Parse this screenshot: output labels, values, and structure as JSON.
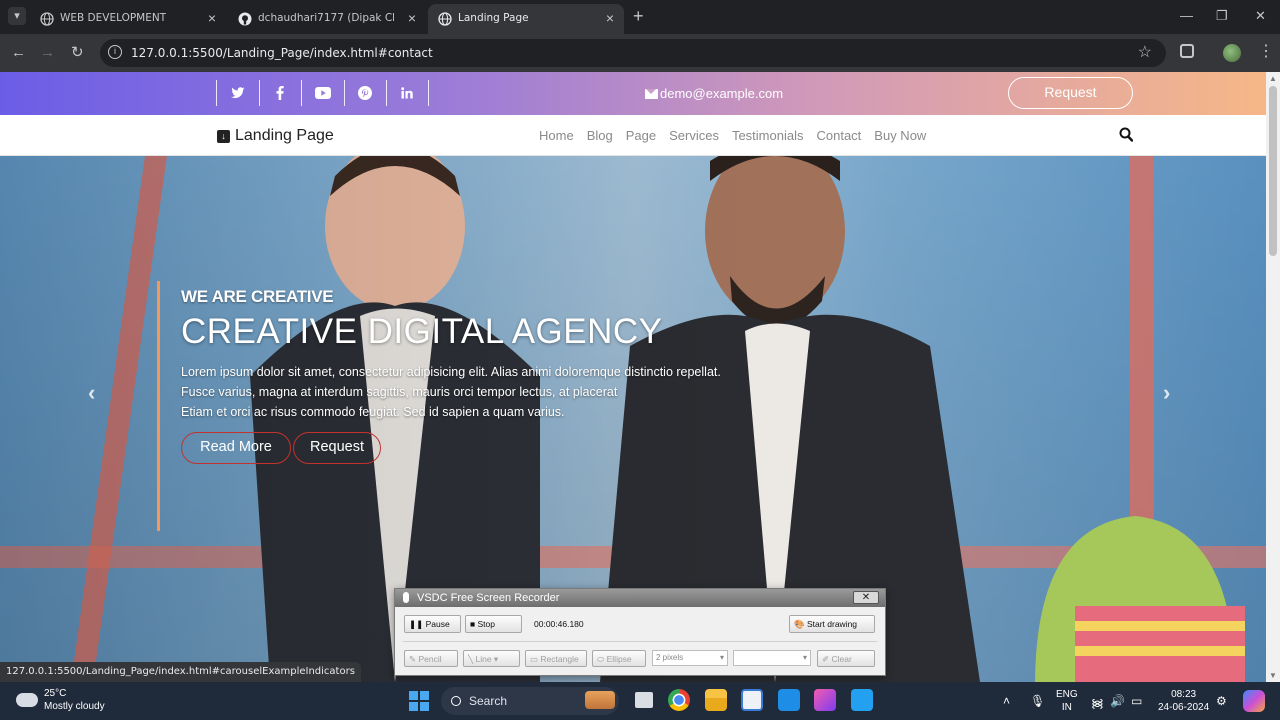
{
  "browser": {
    "tabs": [
      {
        "label": "WEB DEVELOPMENT",
        "active": false,
        "icon": "globe-icon"
      },
      {
        "label": "dchaudhari7177 (Dipak Chaudh",
        "active": false,
        "icon": "github-icon"
      },
      {
        "label": "Landing Page",
        "active": true,
        "icon": "globe-icon"
      }
    ],
    "url": "127.0.0.1:5500/Landing_Page/index.html#contact",
    "status_url": "127.0.0.1:5500/Landing_Page/index.html#carouselExampleIndicators"
  },
  "topbar": {
    "socials": [
      "twitter-icon",
      "facebook-icon",
      "youtube-icon",
      "pinterest-icon",
      "linkedin-icon"
    ],
    "email": "demo@example.com",
    "request_label": "Request"
  },
  "navbar": {
    "brand": "Landing Page",
    "links": [
      "Home",
      "Blog",
      "Page",
      "Services",
      "Testimonials",
      "Contact",
      "Buy Now"
    ]
  },
  "hero": {
    "kicker": "WE ARE CREATIVE",
    "title": "CREATIVE DIGITAL AGENCY",
    "desc_lines": [
      "Lorem ipsum dolor sit amet, consectetur adipisicing elit. Alias animi doloremque distinctio repellat.",
      "Fusce varius, magna at interdum sagittis, mauris orci tempor lectus, at placerat",
      "Etiam et orci ac risus commodo feugiat. Sed id sapien a quam varius."
    ],
    "read_more": "Read More",
    "request": "Request"
  },
  "recorder": {
    "title": "VSDC Free Screen Recorder",
    "pause": "Pause",
    "stop": "Stop",
    "time": "00:00:46.180",
    "start_drawing": "Start drawing",
    "tools": [
      "Pencil",
      "Line",
      "Rectangle",
      "Ellipse"
    ],
    "stroke": "2 pixels",
    "clear": "Clear"
  },
  "taskbar": {
    "temp": "25°C",
    "weather": "Mostly cloudy",
    "search": "Search",
    "lang1": "ENG",
    "lang2": "IN",
    "time": "08:23",
    "date": "24-06-2024"
  },
  "colors": {
    "gradient_start": "#6b5de6",
    "gradient_end": "#f6b787",
    "accent_line": "#f39a5b",
    "button_border": "#c2332f"
  }
}
